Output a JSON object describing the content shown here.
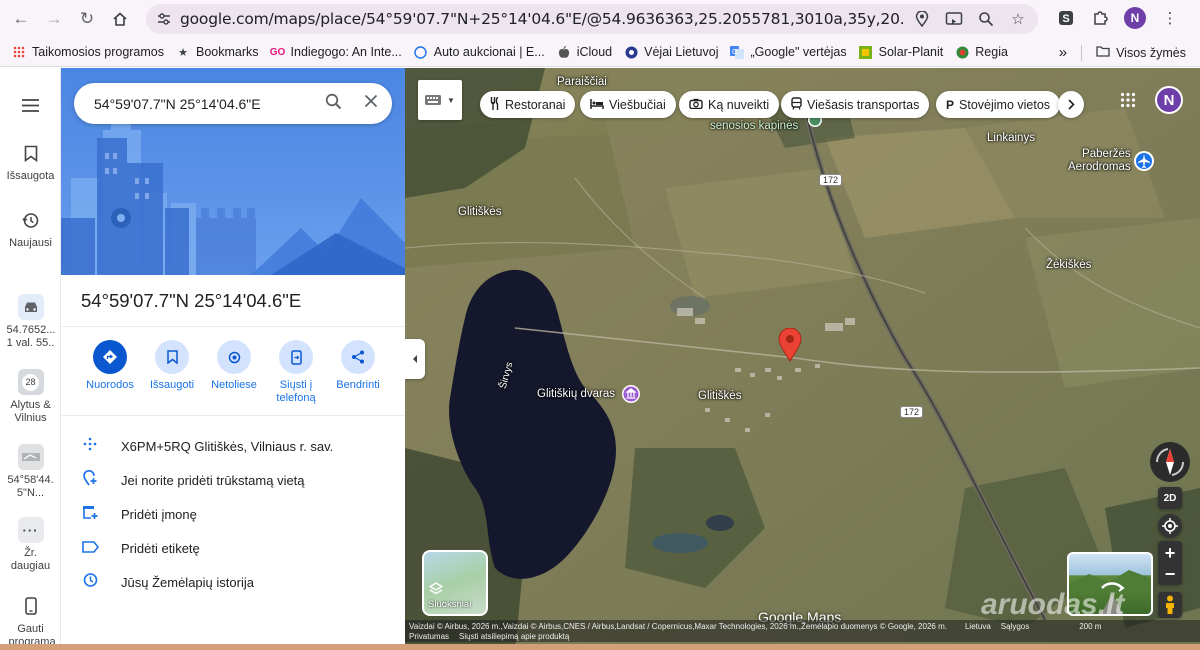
{
  "browser": {
    "url": "google.com/maps/place/54°59'07.7\"N+25°14'04.6\"E/@54.9636363,25.2055781,3010a,35y,20.55h,44.3t/data=!3...",
    "profile_initial": "N",
    "bookmarks": [
      {
        "label": "Taikomosios programos",
        "icon": "apps-grid-icon"
      },
      {
        "label": "Bookmarks",
        "icon": "star-icon"
      },
      {
        "label": "Indiegogo: An Inte...",
        "icon": "indiegogo-icon"
      },
      {
        "label": "Auto aukcionai | E...",
        "icon": "globe-icon"
      },
      {
        "label": "iCloud",
        "icon": "apple-icon"
      },
      {
        "label": "Vėjai Lietuvoj",
        "icon": "wind-icon"
      },
      {
        "label": "„Google\" vertėjas",
        "icon": "translate-icon"
      },
      {
        "label": "Solar-Planit",
        "icon": "solar-icon"
      },
      {
        "label": "Regia",
        "icon": "regia-icon"
      }
    ],
    "more_bookmarks": "»",
    "all_bookmarks": "Visos žymės"
  },
  "rail": {
    "items": [
      {
        "label": "",
        "icon": "menu-icon"
      },
      {
        "label": "Išsaugota",
        "icon": "bookmark-icon"
      },
      {
        "label": "Naujausi",
        "icon": "history-icon"
      },
      {
        "label": "54.7652... 1 val. 55..",
        "icon": "car-icon"
      },
      {
        "label": "Alytus & Vilnius",
        "icon": "route-thumb-icon",
        "badge": "28"
      },
      {
        "label": "54°58'44. 5\"N...",
        "icon": "map-thumb-icon"
      },
      {
        "label": "Žr. daugiau",
        "icon": "more-icon"
      },
      {
        "label": "Gauti programą",
        "icon": "phone-icon"
      }
    ]
  },
  "panel": {
    "search_value": "54°59'07.7\"N 25°14'04.6\"E",
    "title": "54°59'07.7\"N 25°14'04.6\"E",
    "actions": [
      {
        "label": "Nuorodos",
        "icon": "directions-icon"
      },
      {
        "label": "Išsaugoti",
        "icon": "bookmark-icon"
      },
      {
        "label": "Netoliese",
        "icon": "nearby-icon"
      },
      {
        "label": "Siųsti į telefoną",
        "icon": "send-to-phone-icon"
      },
      {
        "label": "Bendrinti",
        "icon": "share-icon"
      }
    ],
    "info_rows": [
      {
        "text": "X6PM+5RQ Glitiškės, Vilniaus r. sav.",
        "icon": "plus-code-icon"
      },
      {
        "text": "Jei norite pridėti trūkstamą vietą",
        "icon": "add-place-icon"
      },
      {
        "text": "Pridėti įmonę",
        "icon": "add-business-icon"
      },
      {
        "text": "Pridėti etiketę",
        "icon": "label-icon"
      },
      {
        "text": "Jūsų Žemėlapių istorija",
        "icon": "history-icon"
      }
    ]
  },
  "map": {
    "chips": [
      {
        "label": "Restoranai",
        "icon": "restaurant-icon"
      },
      {
        "label": "Viešbučiai",
        "icon": "hotel-icon"
      },
      {
        "label": "Ką nuveikti",
        "icon": "camera-icon"
      },
      {
        "label": "Viešasis transportas",
        "icon": "transit-icon"
      },
      {
        "label": "Stovėjimo vietos",
        "icon": "parking-icon"
      }
    ],
    "labels": {
      "paraiscial": "Paraiščiai",
      "kapines": "senosios kapinės",
      "linkainys": "Linkainys",
      "paberzes": "Paberžės\nAerodromas",
      "zekiskes": "Žėkiškės",
      "gitiskes_top": "Glitiškės",
      "sirvys": "Širvys",
      "dvaras": "Glitiškių dvaras",
      "glitiskes": "Glitiškės",
      "road172": "172"
    },
    "layers_label": "Sluoksniai",
    "mode_2d": "2D",
    "zoom_in": "+",
    "zoom_out": "−",
    "logo": "Google Maps",
    "attribution": "Vaizdai © Airbus, 2026 m.,Vaizdai © Airbus,CNES / Airbus,Landsat / Copernicus,Maxar Technologies, 2026 m.,Žemėlapio duomenys © Google, 2026 m.",
    "country": "Lietuva",
    "terms": "Sąlygos",
    "privacy": "Privatumas",
    "feedback": "Siųsti atsiliepimą apie produktą",
    "scale": "200 m",
    "watermark": "aruodas.lt"
  },
  "colors": {
    "accent": "#1a73e8",
    "action_bg": "#d3e3fd",
    "pin": "#ea4335",
    "profile": "#6e3fa8"
  }
}
